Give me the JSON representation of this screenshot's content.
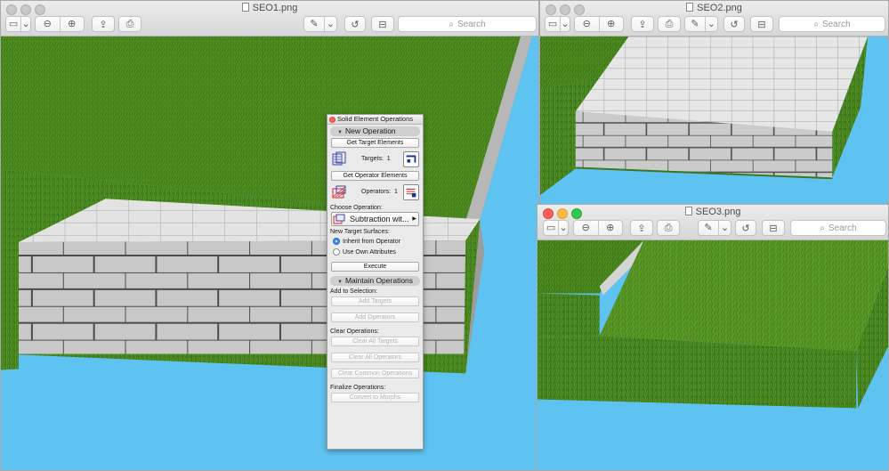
{
  "windows": [
    {
      "id": "seo1",
      "title": "SEO1.png",
      "search_placeholder": "Search"
    },
    {
      "id": "seo2",
      "title": "SEO2.png",
      "search_placeholder": "Search"
    },
    {
      "id": "seo3",
      "title": "SEO3.png",
      "search_placeholder": "Search"
    }
  ],
  "toolbar_icons": [
    "sidebar-icon",
    "chevron-down-icon",
    "zoom-out-icon",
    "zoom-in-icon",
    "share-icon",
    "print-icon",
    "pen-icon",
    "rotate-icon",
    "toolbox-icon",
    "search-icon"
  ],
  "palette": {
    "title": "Solid Element Operations",
    "new_operation": "New Operation",
    "get_target": "Get Target Elements",
    "targets_label": "Targets:",
    "targets_count": "1",
    "get_operator": "Get Operator Elements",
    "operators_label": "Operators:",
    "operators_count": "1",
    "choose_operation": "Choose Operation:",
    "operation_value": "Subtraction wit...",
    "new_target_surfaces": "New Target Surfaces:",
    "inherit": "Inherit from Operator",
    "own": "Use Own Attributes",
    "execute": "Execute",
    "maintain": "Maintain Operations",
    "add_to_selection": "Add to Selection:",
    "add_targets": "Add Targets",
    "add_operators": "Add Operators",
    "clear_operations": "Clear Operations:",
    "clear_targets": "Clear All Targets",
    "clear_operators": "Clear All Operators",
    "clear_common": "Clear Common Operations",
    "finalize": "Finalize Operations:",
    "convert": "Convert to Morphs"
  },
  "colors": {
    "sky": "#5fc3f2",
    "grass": "#4f8f22",
    "stone": "#c9c9c9",
    "accent_radio": "#3d8ee7"
  }
}
